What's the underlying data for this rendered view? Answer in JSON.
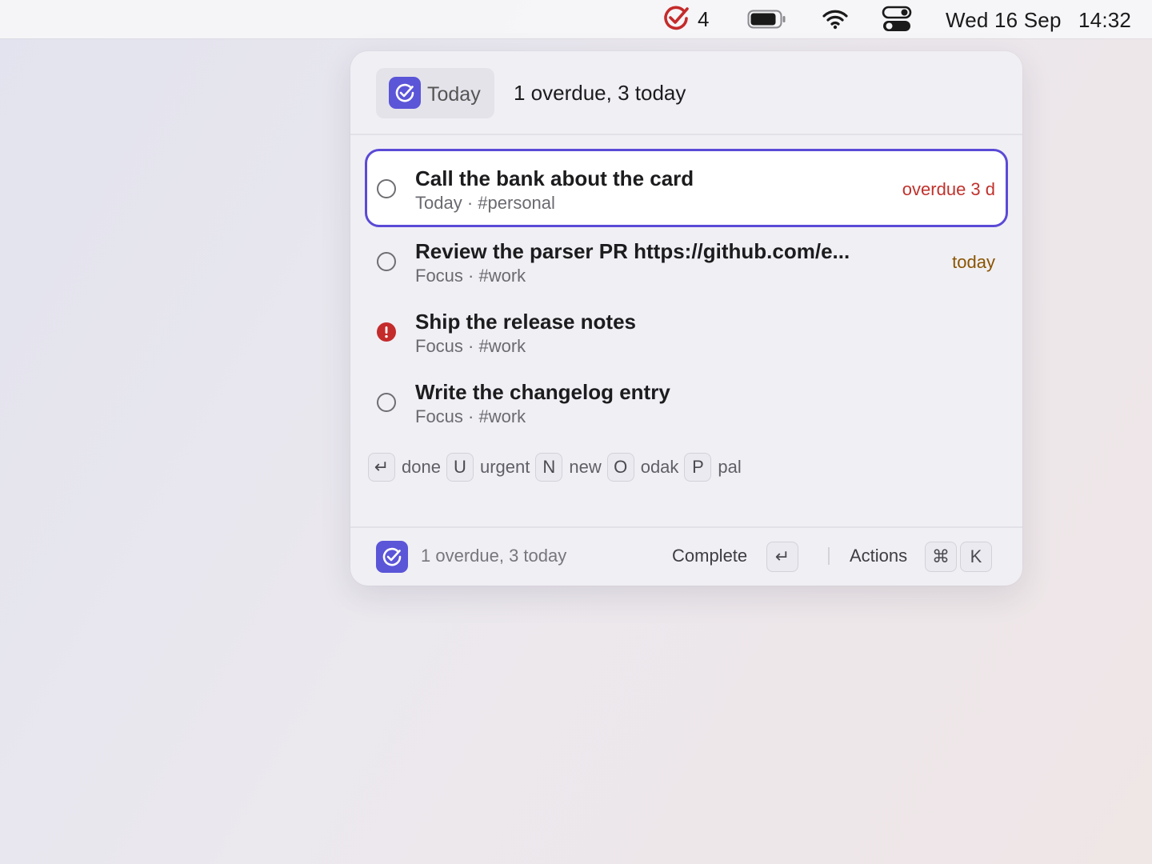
{
  "menubar": {
    "app_badge_count": "4",
    "date": "Wed 16 Sep",
    "time": "14:32",
    "icons": [
      "todo-app-icon",
      "battery-icon",
      "wifi-icon",
      "control-center-icon"
    ],
    "accent_color": "#c42b2b"
  },
  "panel": {
    "header": {
      "view_label": "Today",
      "summary": "1 overdue, 3 today"
    },
    "tasks": [
      {
        "title": "Call the bank about the card",
        "project": "Today",
        "tag": "#personal",
        "due": "overdue 3 d",
        "due_status": "overdue",
        "urgent": false,
        "selected": true
      },
      {
        "title": "Review the parser PR https://github.com/e...",
        "project": "Focus",
        "tag": "#work",
        "due": "today",
        "due_status": "today",
        "urgent": false,
        "selected": false
      },
      {
        "title": "Ship the release notes",
        "project": "Focus",
        "tag": "#work",
        "due": "",
        "due_status": "",
        "urgent": true,
        "selected": false
      },
      {
        "title": "Write the changelog entry",
        "project": "Focus",
        "tag": "#work",
        "due": "",
        "due_status": "",
        "urgent": false,
        "selected": false
      }
    ],
    "hints": [
      {
        "key": "↵",
        "label": "done"
      },
      {
        "key": "U",
        "label": "urgent"
      },
      {
        "key": "N",
        "label": "new"
      },
      {
        "key": "O",
        "label": "odak"
      },
      {
        "key": "P",
        "label": "pal"
      }
    ],
    "footer": {
      "summary": "1 overdue, 3 today",
      "complete_label": "Complete",
      "complete_key": "↵",
      "actions_label": "Actions",
      "actions_keys": [
        "⌘",
        "K"
      ]
    },
    "colors": {
      "brand": "#5b55d8",
      "selection_border": "#5a4ad6",
      "overdue": "#c0322d",
      "today": "#8a5400"
    }
  }
}
